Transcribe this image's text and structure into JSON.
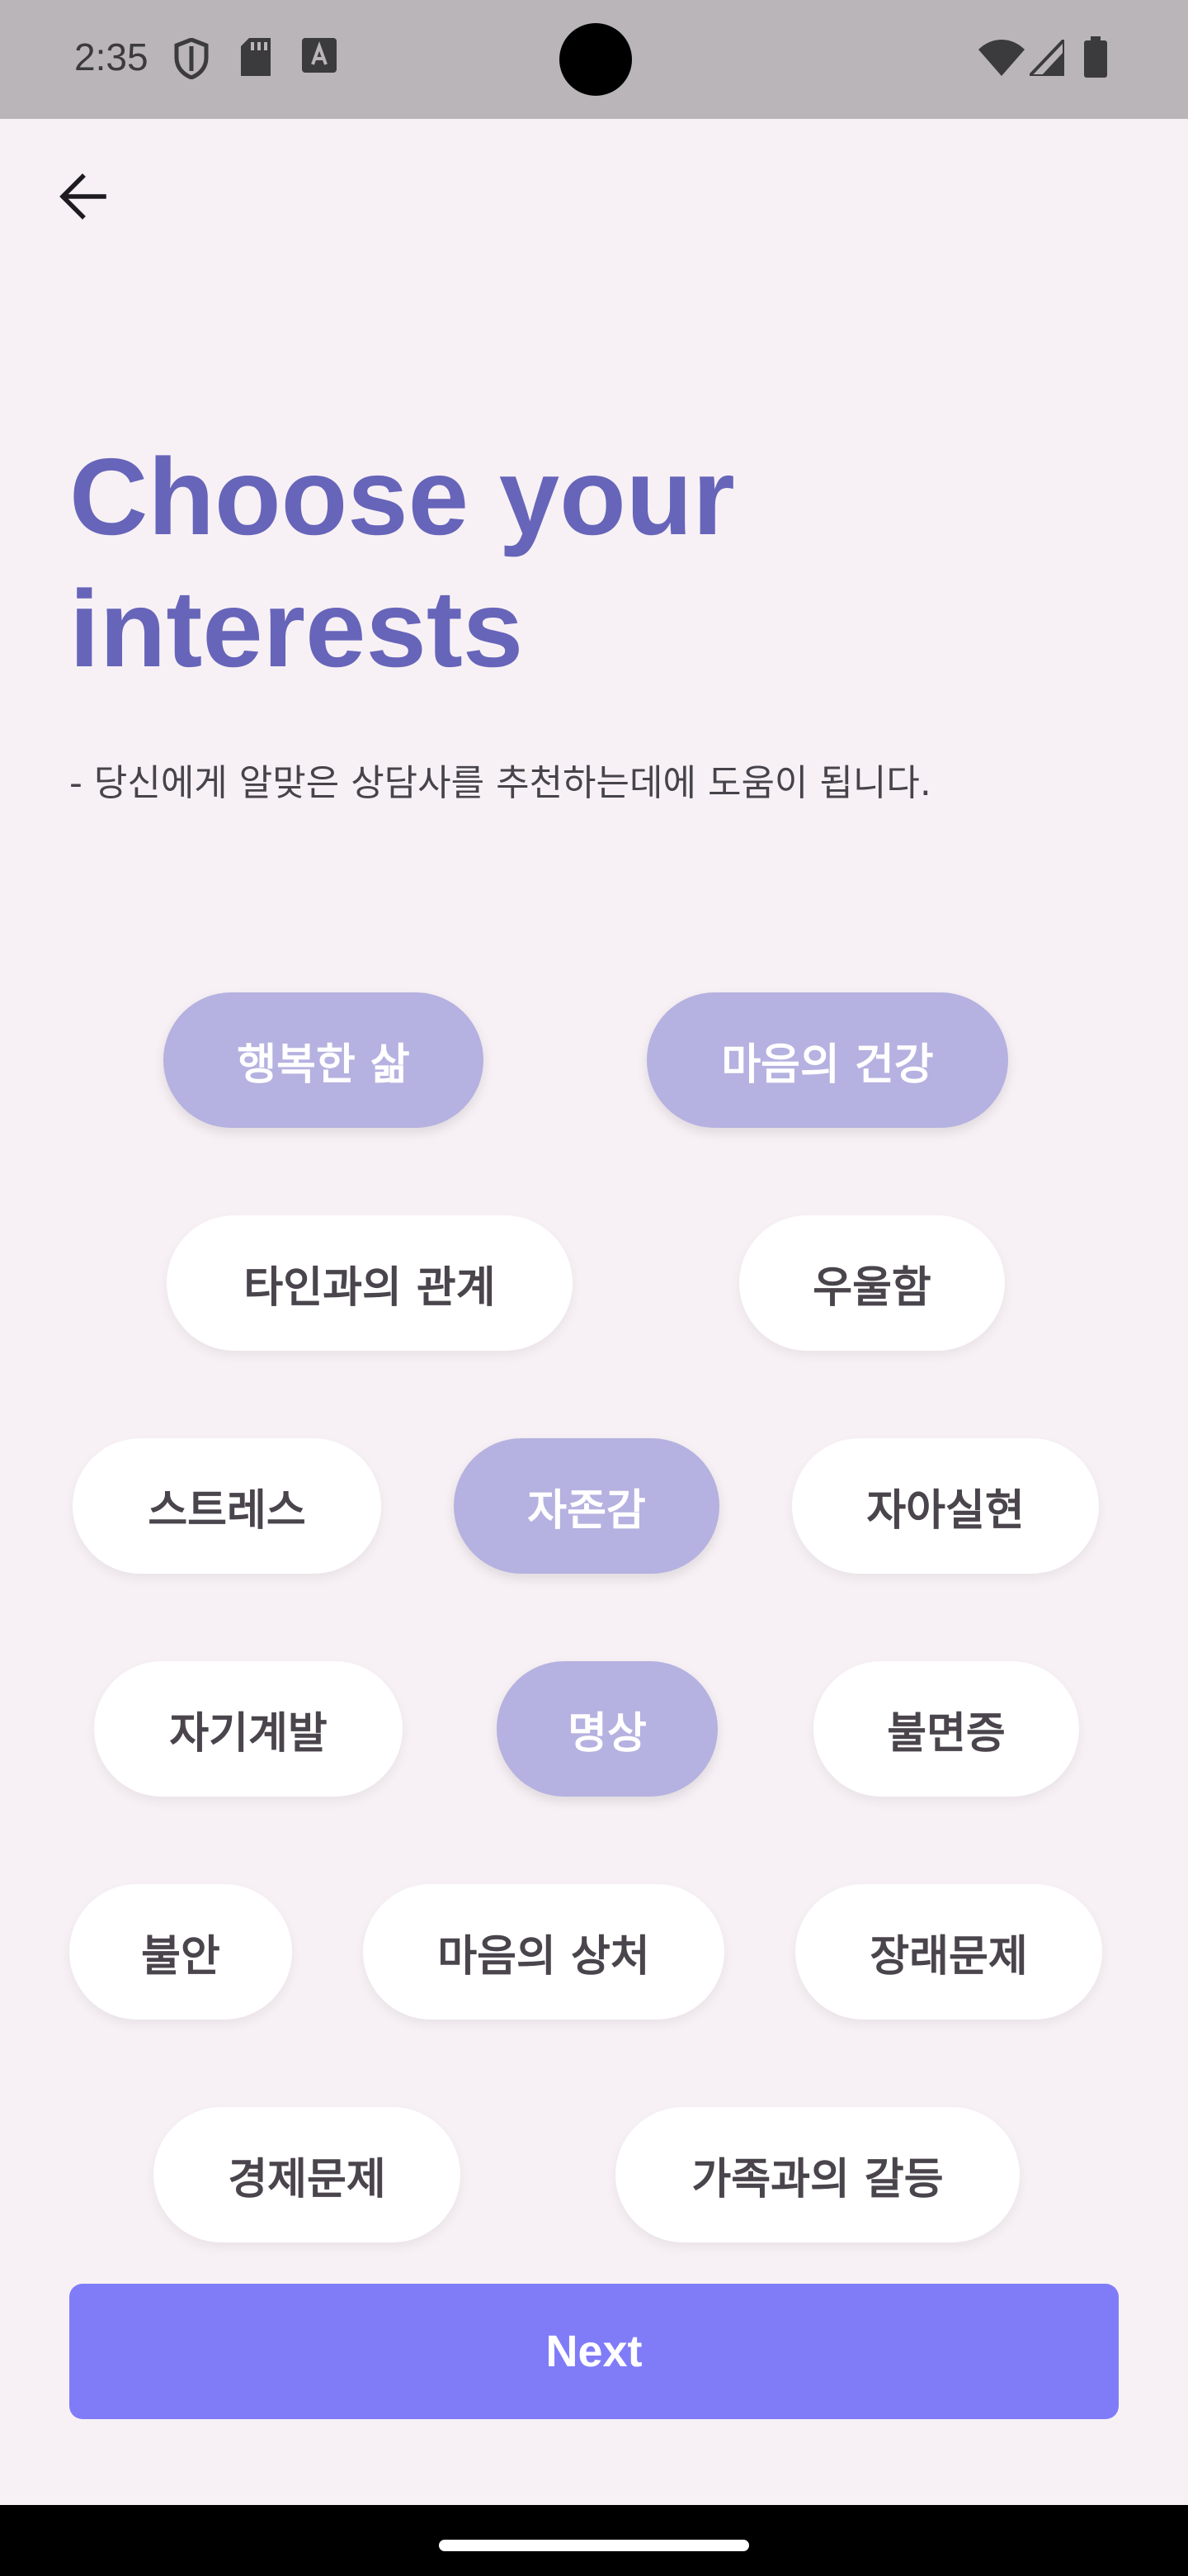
{
  "status_bar": {
    "time": "2:35",
    "left_icons": [
      "shield-icon",
      "sd-card-icon",
      "font-download-icon"
    ],
    "right_icons": [
      "wifi-icon",
      "signal-icon",
      "battery-icon"
    ]
  },
  "app_bar": {
    "back_icon": "arrow-left-icon"
  },
  "page": {
    "title_line1": "Choose your",
    "title_line2": "interests",
    "subtitle": "- 당신에게 알맞은 상담사를 추천하는데에 도움이 됩니다."
  },
  "chips": [
    {
      "label": "행복한 삶",
      "selected": true
    },
    {
      "label": "마음의 건강",
      "selected": true
    },
    {
      "label": "타인과의 관계",
      "selected": false
    },
    {
      "label": "우울함",
      "selected": false
    },
    {
      "label": "스트레스",
      "selected": false
    },
    {
      "label": "자존감",
      "selected": true
    },
    {
      "label": "자아실현",
      "selected": false
    },
    {
      "label": "자기계발",
      "selected": false
    },
    {
      "label": "명상",
      "selected": true
    },
    {
      "label": "불면증",
      "selected": false
    },
    {
      "label": "불안",
      "selected": false
    },
    {
      "label": "마음의 상처",
      "selected": false
    },
    {
      "label": "장래문제",
      "selected": false
    },
    {
      "label": "경제문제",
      "selected": false
    },
    {
      "label": "가족과의 갈등",
      "selected": false
    }
  ],
  "next_button": {
    "label": "Next"
  },
  "colors": {
    "title": "#6765b9",
    "chip_selected": "#b5b1e0",
    "chip_unselected": "#ffffff",
    "next_button": "#807cf8",
    "background": "#f7f1f5"
  }
}
